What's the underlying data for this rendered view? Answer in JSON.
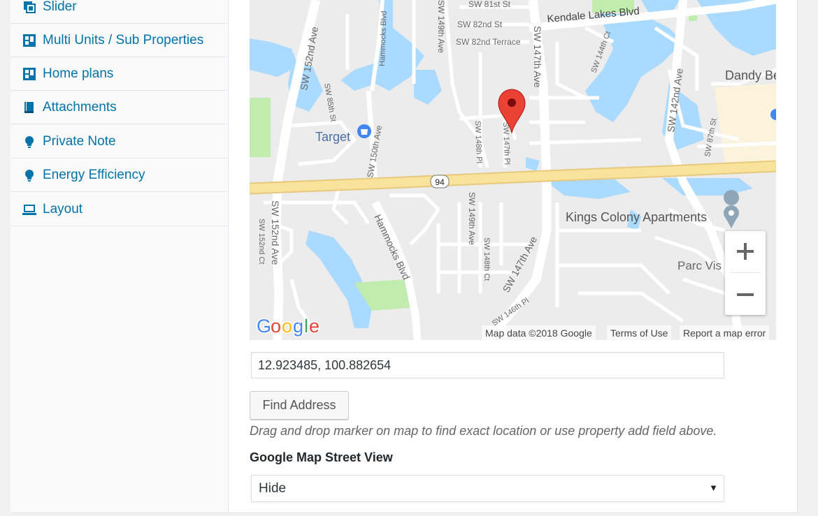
{
  "sidebar": {
    "items": [
      {
        "label": "Slider",
        "icon": "slider-icon"
      },
      {
        "label": "Multi Units / Sub Properties",
        "icon": "layout-grid-icon"
      },
      {
        "label": "Home plans",
        "icon": "layout-grid-icon"
      },
      {
        "label": "Attachments",
        "icon": "book-icon"
      },
      {
        "label": "Private Note",
        "icon": "lightbulb-icon"
      },
      {
        "label": "Energy Efficiency",
        "icon": "lightbulb-icon"
      },
      {
        "label": "Layout",
        "icon": "laptop-icon"
      }
    ]
  },
  "map": {
    "labels": {
      "kendale": "Kendale Lakes Blvd",
      "sw81": "SW 81st St",
      "sw82": "SW 82nd St",
      "sw82t": "SW 82nd Terrace",
      "sw152": "SW 152nd Ave",
      "sw152b": "SW 152nd Ave",
      "sw152ct": "SW 152nd Ct",
      "sw147": "SW 147th Ave",
      "sw147b": "SW 147th Ave",
      "sw142": "SW 142nd Ave",
      "sw149": "SW 149th Ave",
      "sw149b": "SW 149th Ave",
      "sw150": "SW 150th Ave",
      "sw148pl": "SW 148th Pl",
      "sw148ct": "SW 148th Ct",
      "sw147pl": "SW 147th Pl",
      "sw144ct": "SW 144th Ct",
      "sw146pl": "SW 146th Pl",
      "sw87ct": "SW 87th St",
      "sw85": "SW 85th St",
      "hammocks1": "Hammocks Blvd",
      "hammocks2": "Hammocks Blvd",
      "target": "Target",
      "kings": "Kings Colony Apartments",
      "dandy": "Dandy Be",
      "parc": "Parc Vis",
      "route": "94"
    },
    "logo": "Google",
    "attribution": {
      "data": "Map data ©2018 Google",
      "terms": "Terms of Use",
      "report": "Report a map error"
    }
  },
  "form": {
    "coordinates_value": "12.923485, 100.882654",
    "find_button": "Find Address",
    "hint": "Drag and drop marker on map to find exact location or use property add field above.",
    "street_view_label": "Google Map Street View",
    "street_view_selected": "Hide"
  },
  "colors": {
    "link": "#0073aa",
    "water": "#aadaff",
    "park": "#c0ecae",
    "highway": "#f9e29c",
    "marker": "#ea4335"
  }
}
